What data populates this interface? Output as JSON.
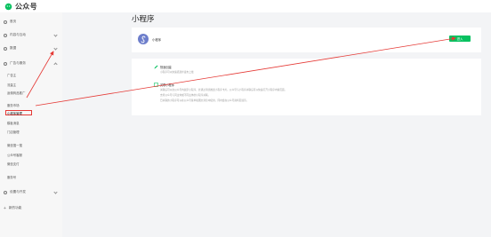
{
  "app": {
    "title": "公众号"
  },
  "sidebar": {
    "items": [
      {
        "label": "首页"
      },
      {
        "label": "内容与互动"
      },
      {
        "label": "数据"
      },
      {
        "label": "广告与服务"
      },
      {
        "label": "设置与开发"
      },
      {
        "label": "新的功能"
      }
    ],
    "ads_sub": [
      {
        "label": "广告主"
      },
      {
        "label": "流量主"
      },
      {
        "label": "返佣商品推广"
      },
      {
        "label": "服务市场"
      },
      {
        "label": "小程序管理"
      },
      {
        "label": "模板消息"
      },
      {
        "label": "门店管理"
      },
      {
        "label": "微信搜一搜"
      },
      {
        "label": "公众号客服"
      },
      {
        "label": "微信支付"
      },
      {
        "label": "服务号"
      }
    ]
  },
  "main": {
    "page_title": "小程序",
    "mini_program": {
      "name": "小程序",
      "enter_label": "进入"
    },
    "features": [
      {
        "title": "快速创建",
        "desc": "小程序可以快速搭建并发布上线"
      },
      {
        "title": "关联小程序",
        "desc": "关联后可以在公众号内展示小程序，并通过消息推送小程序卡片。公众号与小程序关联后可以快速打开小程序内容页面。"
      }
    ],
    "feature_extra_lines": [
      "支持公众号与同主体或不同主体的小程序关联。",
      "已关联的小程序可以在公众号菜单和图文消息中使用，同时会在公众号资料页展示。"
    ]
  },
  "colors": {
    "accent": "#07c160",
    "highlight": "#e53935",
    "avatar": "#6d7ecb"
  }
}
